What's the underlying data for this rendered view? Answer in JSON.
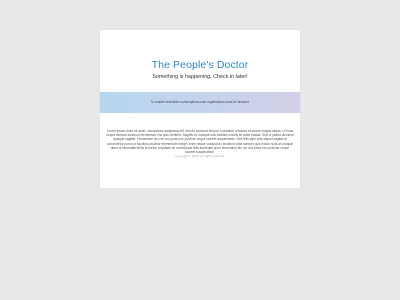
{
  "page": {
    "title": "The People's Doctor",
    "subtitle": "Something is happening. Check in later!",
    "banner_text": "To enable newsletter subscriptions user registrations must be allowed.",
    "body_text": "Lorem ipsum dolor sit amet, consectetur adipiscing elit, sed do eiusmod tempor. Incididunt ut labore et dolore magna aliqua. Ut risus neque aenean euismod elementum nisi quis eleifend. Sagittis eu volutpat odio facilisis mauris sit amet massa. Sed ut platea dictumst quisque sagittis. Fermentum leo vel orci porta non pulvinar neque laoreet suspendisse. Sed felis eget velit aliquet sagittis id consectetur purus ut faucibus pulvinar elementum integer enim neque volutpat ac tincidunt vitae semper quis lectus nulla at volutpat diam ut venenatis tellus in metus vulputate eu scelerisque felis imperdiet proin fermentum leo vel orci porta non pulvinar neque laoreet suspendisse.",
    "copyright": "Copyright © 2020. All rights reserved."
  },
  "colors": {
    "title": "#2f86c0",
    "background": "#e8e8e8",
    "card": "#ffffff",
    "banner_start": "#b4d6f0",
    "banner_end": "#d2cfe6"
  }
}
